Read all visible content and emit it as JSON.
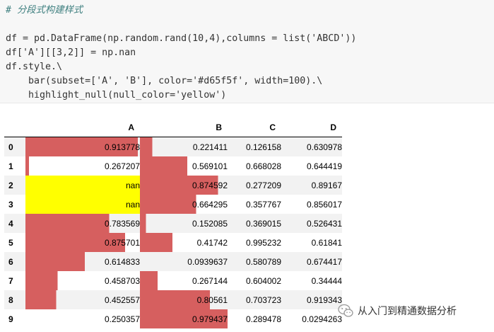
{
  "code": {
    "lines": [
      "# 分段式构建样式",
      "",
      "df = pd.DataFrame(np.random.rand(10,4),columns = list('ABCD'))",
      "df['A'][[3,2]] = np.nan",
      "df.style.\\",
      "    bar(subset=['A', 'B'], color='#d65f5f', width=100).\\",
      "    highlight_null(null_color='yellow')"
    ]
  },
  "table": {
    "columns": [
      "",
      "A",
      "B",
      "C",
      "D"
    ],
    "rows": [
      {
        "index": "0",
        "A": "0.913778",
        "B": "0.221411",
        "C": "0.126158",
        "D": "0.630978"
      },
      {
        "index": "1",
        "A": "0.267207",
        "B": "0.569101",
        "C": "0.668028",
        "D": "0.644419"
      },
      {
        "index": "2",
        "A": "nan",
        "B": "0.874592",
        "C": "0.277209",
        "D": "0.89167"
      },
      {
        "index": "3",
        "A": "nan",
        "B": "0.664295",
        "C": "0.357767",
        "D": "0.856017"
      },
      {
        "index": "4",
        "A": "0.783569",
        "B": "0.152085",
        "C": "0.369015",
        "D": "0.526431"
      },
      {
        "index": "5",
        "A": "0.875701",
        "B": "0.41742",
        "C": "0.995232",
        "D": "0.61841"
      },
      {
        "index": "6",
        "A": "0.614833",
        "B": "0.0939637",
        "C": "0.580789",
        "D": "0.674417"
      },
      {
        "index": "7",
        "A": "0.458703",
        "B": "0.267144",
        "C": "0.604002",
        "D": "0.34444"
      },
      {
        "index": "8",
        "A": "0.452557",
        "B": "0.80561",
        "C": "0.703723",
        "D": "0.919343"
      },
      {
        "index": "9",
        "A": "0.250357",
        "B": "0.979437",
        "C": "0.289478",
        "D": "0.0294263"
      }
    ],
    "bar_levels": {
      "A": [
        0.98,
        0.03,
        null,
        null,
        0.73,
        0.87,
        0.52,
        0.28,
        0.27,
        0.0
      ],
      "B": [
        0.14,
        0.54,
        0.89,
        0.64,
        0.07,
        0.37,
        0.0,
        0.2,
        0.8,
        1.0
      ]
    },
    "colors": {
      "bar": "#d65f5f",
      "null_highlight": "#ffff00",
      "stripe": "#f2f2f2"
    }
  },
  "watermark": {
    "icon": "wechat-icon",
    "text": "从入门到精通数据分析"
  }
}
